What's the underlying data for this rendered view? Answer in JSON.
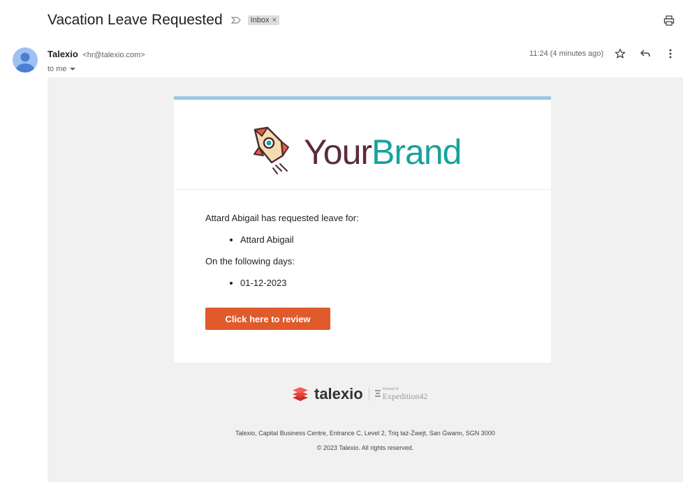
{
  "email": {
    "subject": "Vacation Leave Requested",
    "label_chip": "Inbox",
    "label_remove": "×",
    "sender_name": "Talexio",
    "sender_email": "<hr@talexio.com>",
    "recipient": "to me",
    "time": "11:24 (4 minutes ago)"
  },
  "icons": {
    "importance": "importance-marker-icon",
    "print": "print-icon",
    "star": "star-icon",
    "reply": "reply-icon",
    "more": "more-vert-icon",
    "dropdown": "chevron-down-icon"
  },
  "card": {
    "brand_part1": "Your",
    "brand_part2": "Brand",
    "intro": "Attard Abigail has requested leave for:",
    "employees": [
      "Attard Abigail"
    ],
    "days_label": "On the following days:",
    "days": [
      "01-12-2023"
    ],
    "button_label": "Click here to review"
  },
  "footer": {
    "logo_text": "talexio",
    "partner_small": "A brand of",
    "partner_text": "Expedition42",
    "address": "Talexio, Capital Business Centre, Entrance C, Level 2, Triq taż-Żwejt, San Ġwann, SGN 3000",
    "copyright": "© 2023 Talexio. All rights reserved."
  },
  "colors": {
    "accent_button": "#e05a2b",
    "card_topbar": "#9bc7e6",
    "brand_dark": "#5b2b3d",
    "brand_teal": "#17a39a",
    "talexio_red": "#e8413c"
  }
}
